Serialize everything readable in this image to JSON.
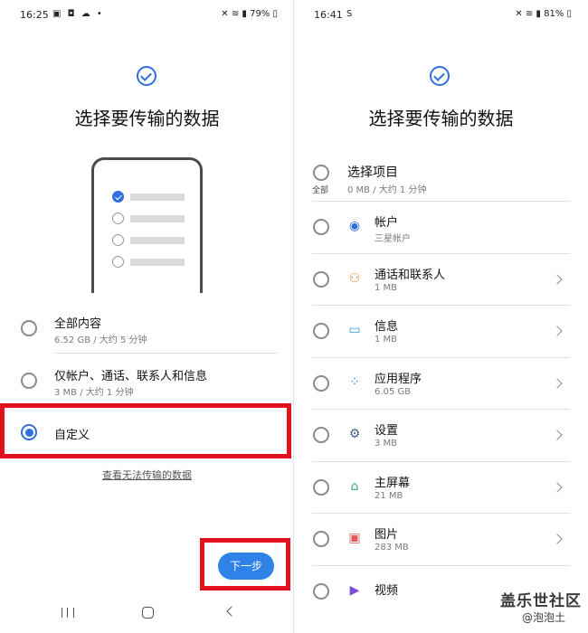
{
  "left": {
    "status": {
      "time": "16:25",
      "icons_left": "▣ ◘ ☁ •",
      "icons_right": "✕ ≋ ▮ 79% ▯"
    },
    "title": "选择要传输的数据",
    "options": [
      {
        "title": "全部内容",
        "sub": "6.52 GB / 大约 5 分钟",
        "selected": false
      },
      {
        "title": "仅帐户、通话、联系人和信息",
        "sub": "3 MB / 大约 1 分钟",
        "selected": false
      },
      {
        "title": "自定义",
        "sub": "",
        "selected": true
      }
    ],
    "link": "查看无法传输的数据",
    "next_button": "下一步"
  },
  "right": {
    "status": {
      "time": "16:41",
      "icons_left": "S",
      "icons_right": "✕ ≋ ▮ 81% ▯"
    },
    "title": "选择要传输的数据",
    "select_all": {
      "title": "选择项目",
      "sub": "0 MB / 大约 1 分钟",
      "label": "全部"
    },
    "items": [
      {
        "title": "帐户",
        "sub": "三星帐户",
        "icon": "account-icon",
        "color": "#2f6fde",
        "chevron": false
      },
      {
        "title": "通话和联系人",
        "sub": "1 MB",
        "icon": "contact-icon",
        "color": "#f08a3c",
        "chevron": true
      },
      {
        "title": "信息",
        "sub": "1 MB",
        "icon": "message-icon",
        "color": "#2a9bd6",
        "chevron": true
      },
      {
        "title": "应用程序",
        "sub": "6.05 GB",
        "icon": "apps-icon",
        "color": "#2f8fd6",
        "chevron": true
      },
      {
        "title": "设置",
        "sub": "3 MB",
        "icon": "gear-icon",
        "color": "#4a5f8a",
        "chevron": true
      },
      {
        "title": "主屏幕",
        "sub": "21 MB",
        "icon": "home-icon",
        "color": "#3aa57a",
        "chevron": true
      },
      {
        "title": "图片",
        "sub": "283 MB",
        "icon": "image-icon",
        "color": "#e05a5a",
        "chevron": true
      },
      {
        "title": "视频",
        "sub": "",
        "icon": "video-icon",
        "color": "#7b4fd6",
        "chevron": false
      }
    ]
  },
  "watermark": {
    "line1": "盖乐世社区",
    "line2": "@泡泡土"
  }
}
